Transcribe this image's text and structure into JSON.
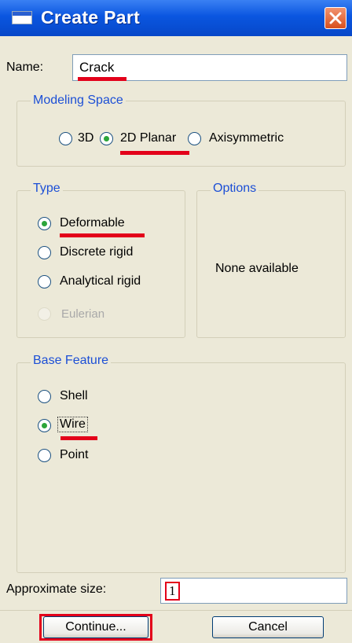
{
  "window": {
    "title": "Create Part",
    "title_icon": "window-icon",
    "close_icon": "close-icon"
  },
  "name_field": {
    "label": "Name:",
    "value": "Crack"
  },
  "modeling_space": {
    "title": "Modeling Space",
    "options": [
      "3D",
      "2D Planar",
      "Axisymmetric"
    ],
    "selected": "2D Planar"
  },
  "type": {
    "title": "Type",
    "options": [
      "Deformable",
      "Discrete rigid",
      "Analytical rigid",
      "Eulerian"
    ],
    "selected": "Deformable",
    "disabled": [
      "Eulerian"
    ]
  },
  "options_group": {
    "title": "Options",
    "message": "None available"
  },
  "base_feature": {
    "title": "Base Feature",
    "options": [
      "Shell",
      "Wire",
      "Point"
    ],
    "selected": "Wire"
  },
  "approx_size": {
    "label": "Approximate size:",
    "value": "1"
  },
  "buttons": {
    "continue": "Continue...",
    "cancel": "Cancel"
  },
  "colors": {
    "annotation_red": "#e3001a",
    "title_blue": "#0a56e0",
    "group_title": "#1c4fd6",
    "radio_dot": "#2ca53a"
  }
}
